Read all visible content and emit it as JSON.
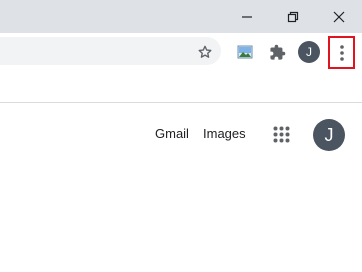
{
  "window": {
    "minimize_icon": "minimize-icon",
    "restore_icon": "restore-icon",
    "close_icon": "close-icon"
  },
  "toolbar": {
    "bookmark_icon": "star-icon",
    "extension_image_icon": "image-extension-icon",
    "extensions_icon": "puzzle-icon",
    "profile_initial": "J",
    "menu_icon": "vertical-dots-icon"
  },
  "gbar": {
    "gmail_label": "Gmail",
    "images_label": "Images",
    "apps_icon": "apps-grid-icon",
    "account_initial": "J"
  },
  "colors": {
    "titlebar": "#dee1e6",
    "avatar": "#4a5561",
    "highlight": "#e0141e"
  }
}
